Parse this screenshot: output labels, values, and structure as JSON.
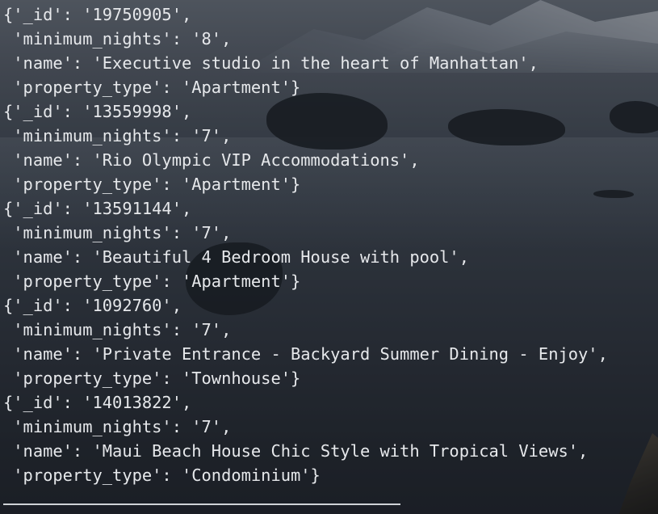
{
  "terminal": {
    "lines": [
      "{'_id': '19750905',",
      " 'minimum_nights': '8',",
      " 'name': 'Executive studio in the heart of Manhattan',",
      " 'property_type': 'Apartment'}",
      "{'_id': '13559998',",
      " 'minimum_nights': '7',",
      " 'name': 'Rio Olympic VIP Accommodations',",
      " 'property_type': 'Apartment'}",
      "{'_id': '13591144',",
      " 'minimum_nights': '7',",
      " 'name': 'Beautiful 4 Bedroom House with pool',",
      " 'property_type': 'Apartment'}",
      "{'_id': '1092760',",
      " 'minimum_nights': '7',",
      " 'name': 'Private Entrance - Backyard Summer Dining - Enjoy',",
      " 'property_type': 'Townhouse'}",
      "{'_id': '14013822',",
      " 'minimum_nights': '7',",
      " 'name': 'Maui Beach House Chic Style with Tropical Views',",
      " 'property_type': 'Condominium'}"
    ]
  },
  "colors": {
    "text": "#e6e8eb",
    "background": "#3f4752"
  }
}
